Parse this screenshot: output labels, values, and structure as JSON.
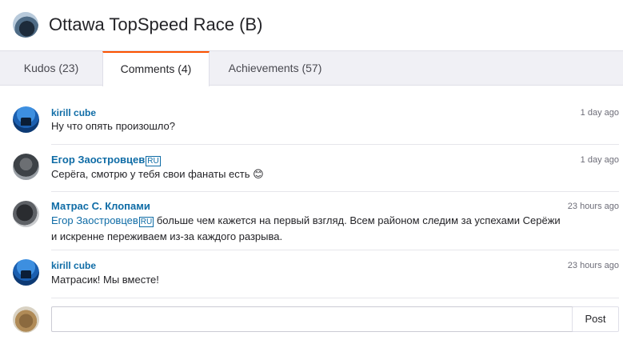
{
  "header": {
    "title": "Ottawa TopSpeed Race (B)"
  },
  "tabs": [
    {
      "label": "Kudos (23)",
      "active": false
    },
    {
      "label": "Comments (4)",
      "active": true
    },
    {
      "label": "Achievements (57)",
      "active": false
    }
  ],
  "comments": [
    {
      "author": "kirill cube",
      "time": "1 day ago",
      "text": "Ну что опять произошло?"
    },
    {
      "author": "Егор Заостровцев",
      "flag": "RU",
      "time": "1 day ago",
      "text": "Серёга, смотрю у тебя свои фанаты есть 😊"
    },
    {
      "author": "Матрас С. Клопами",
      "time": "23 hours ago",
      "mention": "Егор Заостровцев",
      "mention_flag": "RU",
      "text_line1": " больше чем кажется на первый взгляд. Всем районом следим за успехами Серёжи",
      "text_line2": "и искренне переживаем из-за каждого разрыва."
    },
    {
      "author": "kirill cube",
      "time": "23 hours ago",
      "text": "Матрасик! Мы вместе!"
    }
  ],
  "compose": {
    "placeholder": "",
    "post_label": "Post"
  },
  "colors": {
    "accent": "#fc5200",
    "link": "#0f6ca6"
  }
}
